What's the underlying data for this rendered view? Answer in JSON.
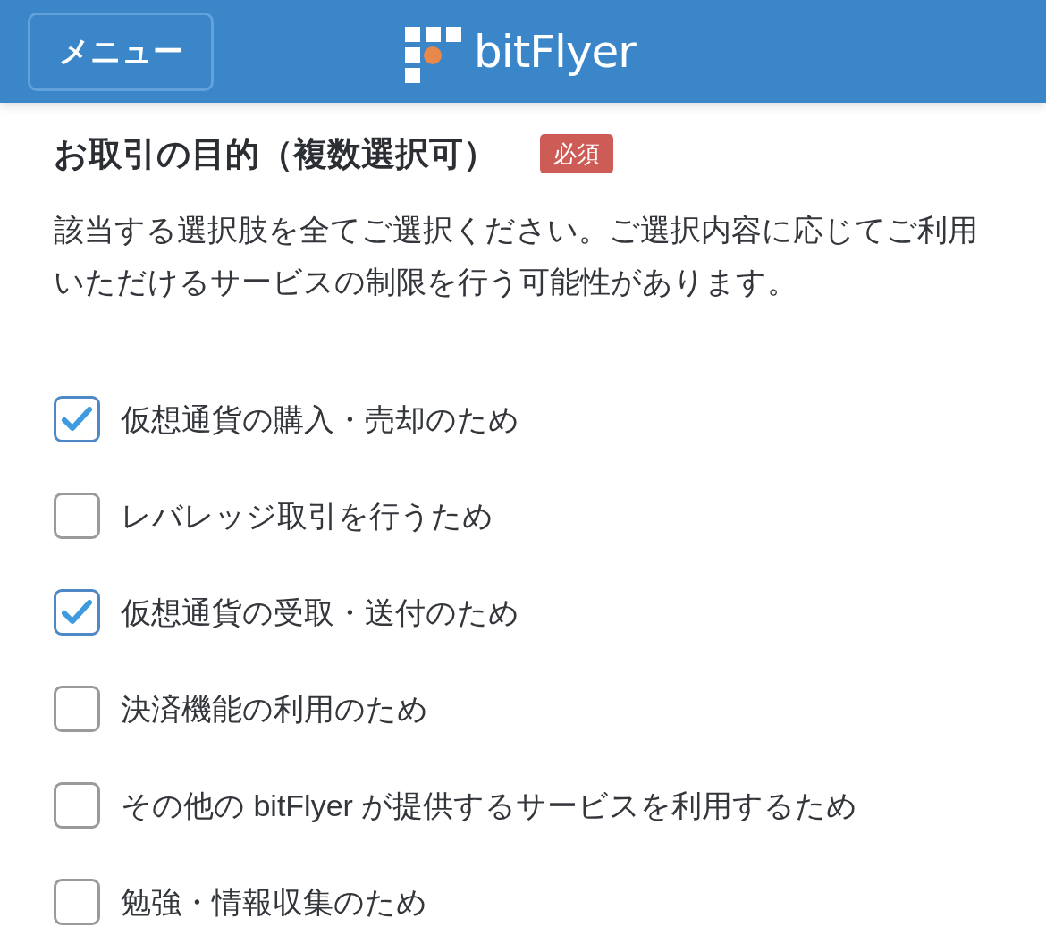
{
  "header": {
    "menu_button": "メニュー",
    "logo_text": "bitFlyer"
  },
  "section": {
    "title": "お取引の目的（複数選択可）",
    "badge": "必須",
    "description": "該当する選択肢を全てご選択ください。ご選択内容に応じてご利用いただけるサービスの制限を行う可能性があります。"
  },
  "options": [
    {
      "label": "仮想通貨の購入・売却のため",
      "checked": true
    },
    {
      "label": "レバレッジ取引を行うため",
      "checked": false
    },
    {
      "label": "仮想通貨の受取・送付のため",
      "checked": true
    },
    {
      "label": "決済機能の利用のため",
      "checked": false
    },
    {
      "label": "その他の bitFlyer が提供するサービスを利用するため",
      "checked": false
    },
    {
      "label": "勉強・情報収集のため",
      "checked": false
    }
  ]
}
